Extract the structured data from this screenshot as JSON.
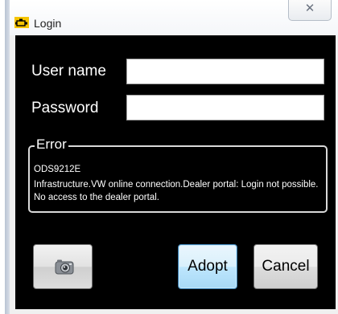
{
  "window": {
    "title": "Login",
    "close_glyph": "✕"
  },
  "form": {
    "username_label": "User name",
    "username_value": "",
    "password_label": "Password",
    "password_value": ""
  },
  "error": {
    "legend": "Error",
    "code": "ODS9212E",
    "message": "Infrastructure.VW online connection.Dealer portal: Login not possible. No access to the dealer portal."
  },
  "buttons": {
    "camera_icon": "camera-icon",
    "adopt_label": "Adopt",
    "cancel_label": "Cancel"
  },
  "colors": {
    "client_background": "#000000",
    "adopt_accent": "#3c7fb1"
  }
}
